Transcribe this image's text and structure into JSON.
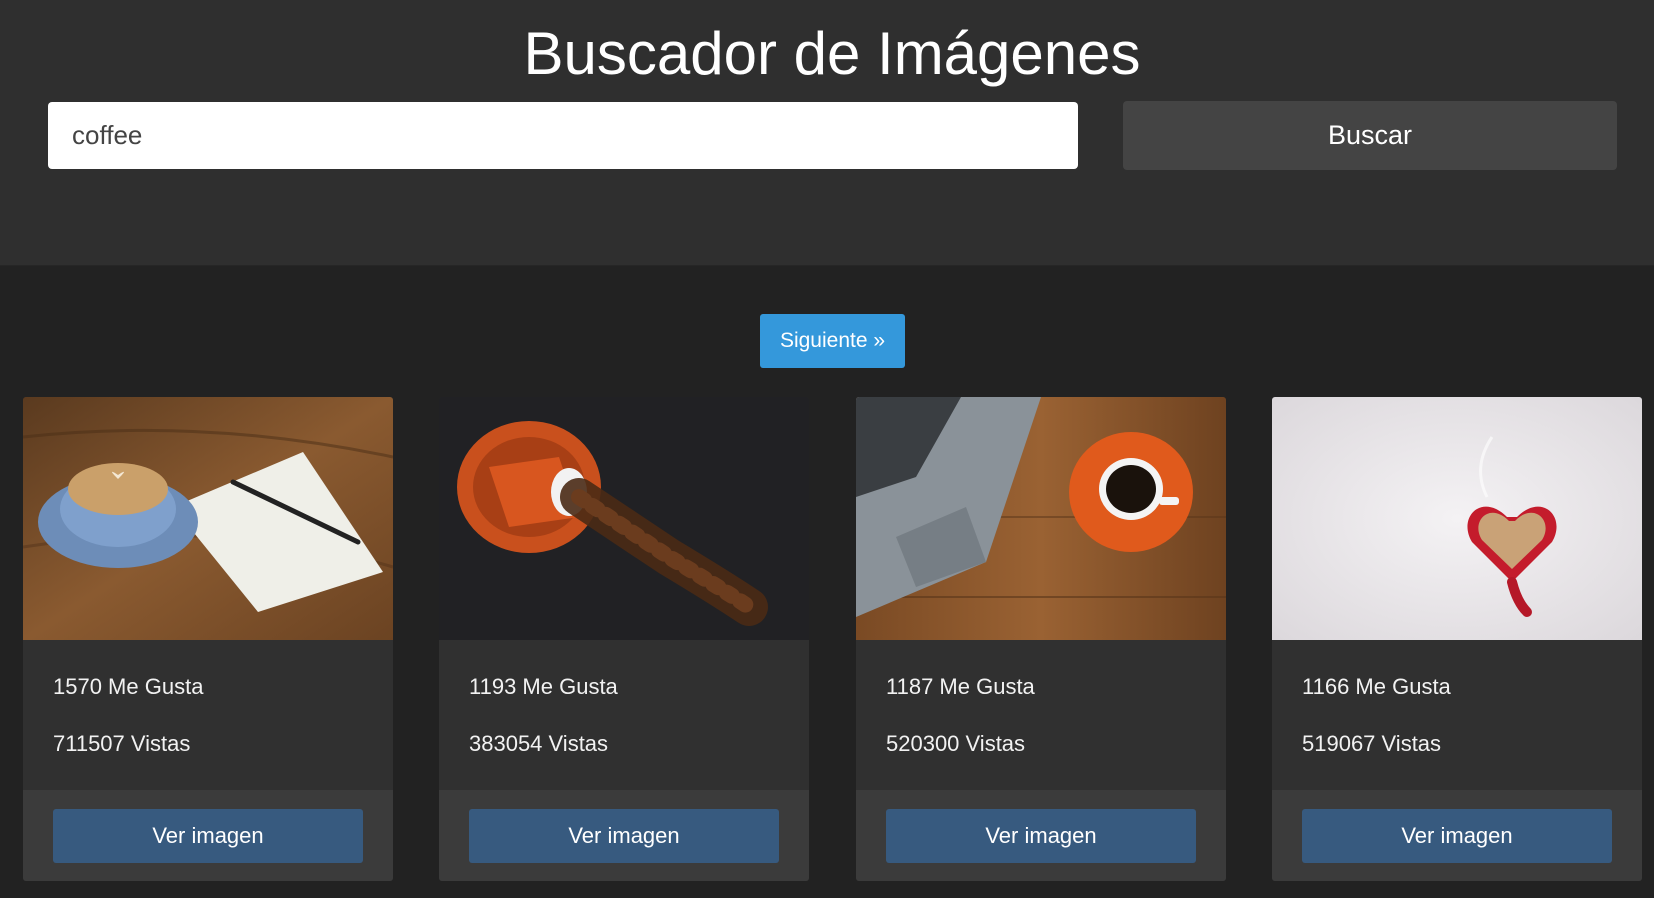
{
  "header": {
    "title": "Buscador de Imágenes",
    "search_value": "coffee",
    "search_button": "Buscar"
  },
  "pagination": {
    "next_label": "Siguiente »"
  },
  "results": [
    {
      "likes": "1570 Me Gusta",
      "views": "711507 Vistas",
      "button": "Ver imagen",
      "image": "latte-notebook-photo"
    },
    {
      "likes": "1193 Me Gusta",
      "views": "383054 Vistas",
      "button": "Ver imagen",
      "image": "spilled-coffee-beans-photo"
    },
    {
      "likes": "1187 Me Gusta",
      "views": "520300 Vistas",
      "button": "Ver imagen",
      "image": "laptop-coffee-cup-photo"
    },
    {
      "likes": "1166 Me Gusta",
      "views": "519067 Vistas",
      "button": "Ver imagen",
      "image": "heart-mug-snow-photo"
    }
  ]
}
